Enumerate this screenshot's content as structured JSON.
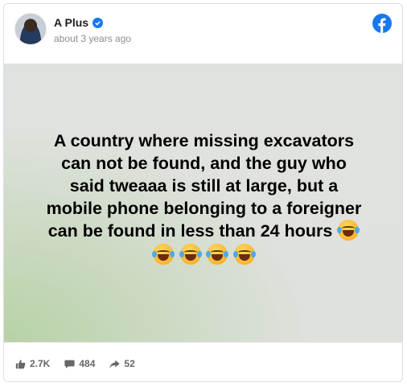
{
  "post": {
    "author": "A Plus",
    "time": "about 3 years ago",
    "text_lines": [
      "A country where missing excavators",
      "can not be found, and the guy who",
      "said tweaaa is still at large, but a",
      "mobile phone belonging to a foreigner",
      "can be found in less than 24 hours"
    ]
  },
  "stats": {
    "likes": "2.7K",
    "comments": "484",
    "shares": "52"
  },
  "icons": {
    "brand": "facebook-icon",
    "verified": "verified-badge-icon",
    "emoji": "face-with-tears-of-joy"
  },
  "colors": {
    "accent": "#1877f2",
    "muted_text": "#8a8d91",
    "post_text": "#000000"
  }
}
